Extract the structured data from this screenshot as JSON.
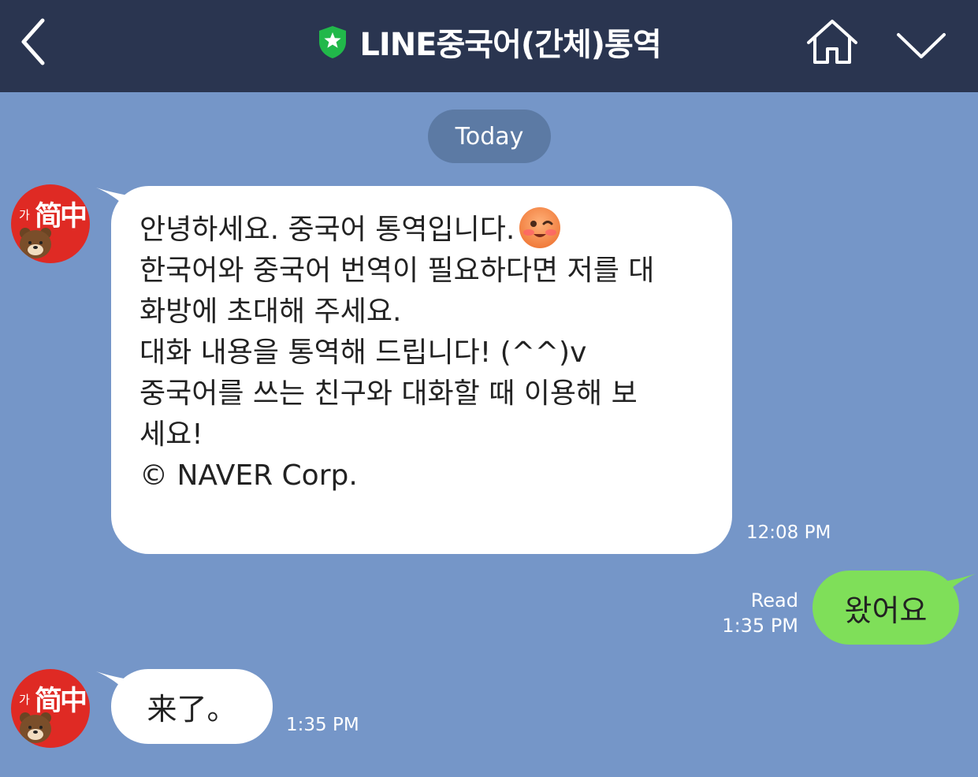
{
  "header": {
    "title": "LINE중국어(간체)통역",
    "back_icon": "chevron-left-icon",
    "verified_icon": "green-shield-star-icon",
    "home_icon": "home-icon",
    "menu_icon": "chevron-down-icon"
  },
  "date_separator": "Today",
  "bot_avatar": {
    "small_text": "가",
    "main_text": "简中"
  },
  "messages": [
    {
      "sender": "bot",
      "lines": [
        "안녕하세요. 중국어 통역입니다.",
        "한국어와 중국어 번역이 필요하다면 저를 대",
        "화방에 초대해 주세요.",
        "대화 내용을 통역해 드립니다! (^^)v",
        "중국어를 쓰는 친구와 대화할 때 이용해 보",
        "세요!",
        "© NAVER Corp."
      ],
      "emoji": "winking-face-emoji",
      "time": "12:08 PM"
    },
    {
      "sender": "me",
      "text": "왔어요",
      "read_label": "Read",
      "time": "1:35 PM"
    },
    {
      "sender": "bot",
      "text": "来了。",
      "time": "1:35 PM"
    }
  ],
  "colors": {
    "header_bg": "#2a3550",
    "chat_bg": "#7596c8",
    "my_bubble": "#7fdf59",
    "bot_bubble": "#ffffff",
    "avatar_red": "#df2a24"
  }
}
